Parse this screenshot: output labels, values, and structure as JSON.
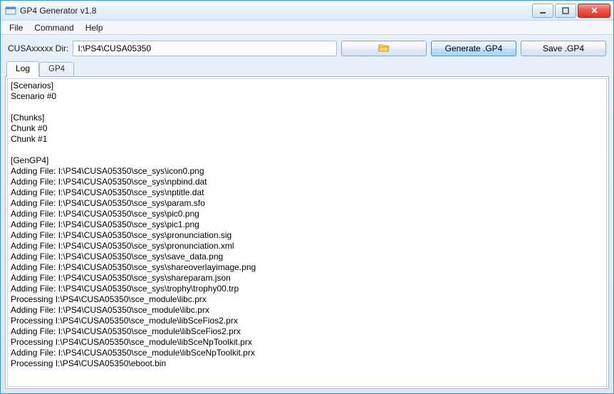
{
  "window": {
    "title": "GP4 Generator v1.8"
  },
  "menu": {
    "file": "File",
    "command": "Command",
    "help": "Help"
  },
  "toolbar": {
    "dir_label": "CUSAxxxxx Dir:",
    "dir_value": "I:\\PS4\\CUSA05350",
    "generate_label": "Generate .GP4",
    "save_label": "Save .GP4"
  },
  "tabs": {
    "log": "Log",
    "gp4": "GP4"
  },
  "log_text": "[Scenarios]\nScenario #0\n\n[Chunks]\nChunk #0\nChunk #1\n\n[GenGP4]\nAdding File: I:\\PS4\\CUSA05350\\sce_sys\\icon0.png\nAdding File: I:\\PS4\\CUSA05350\\sce_sys\\npbind.dat\nAdding File: I:\\PS4\\CUSA05350\\sce_sys\\nptitle.dat\nAdding File: I:\\PS4\\CUSA05350\\sce_sys\\param.sfo\nAdding File: I:\\PS4\\CUSA05350\\sce_sys\\pic0.png\nAdding File: I:\\PS4\\CUSA05350\\sce_sys\\pic1.png\nAdding File: I:\\PS4\\CUSA05350\\sce_sys\\pronunciation.sig\nAdding File: I:\\PS4\\CUSA05350\\sce_sys\\pronunciation.xml\nAdding File: I:\\PS4\\CUSA05350\\sce_sys\\save_data.png\nAdding File: I:\\PS4\\CUSA05350\\sce_sys\\shareoverlayimage.png\nAdding File: I:\\PS4\\CUSA05350\\sce_sys\\shareparam.json\nAdding File: I:\\PS4\\CUSA05350\\sce_sys\\trophy\\trophy00.trp\nProcessing I:\\PS4\\CUSA05350\\sce_module\\libc.prx\nAdding File: I:\\PS4\\CUSA05350\\sce_module\\libc.prx\nProcessing I:\\PS4\\CUSA05350\\sce_module\\libSceFios2.prx\nAdding File: I:\\PS4\\CUSA05350\\sce_module\\libSceFios2.prx\nProcessing I:\\PS4\\CUSA05350\\sce_module\\libSceNpToolkit.prx\nAdding File: I:\\PS4\\CUSA05350\\sce_module\\libSceNpToolkit.prx\nProcessing I:\\PS4\\CUSA05350\\eboot.bin"
}
